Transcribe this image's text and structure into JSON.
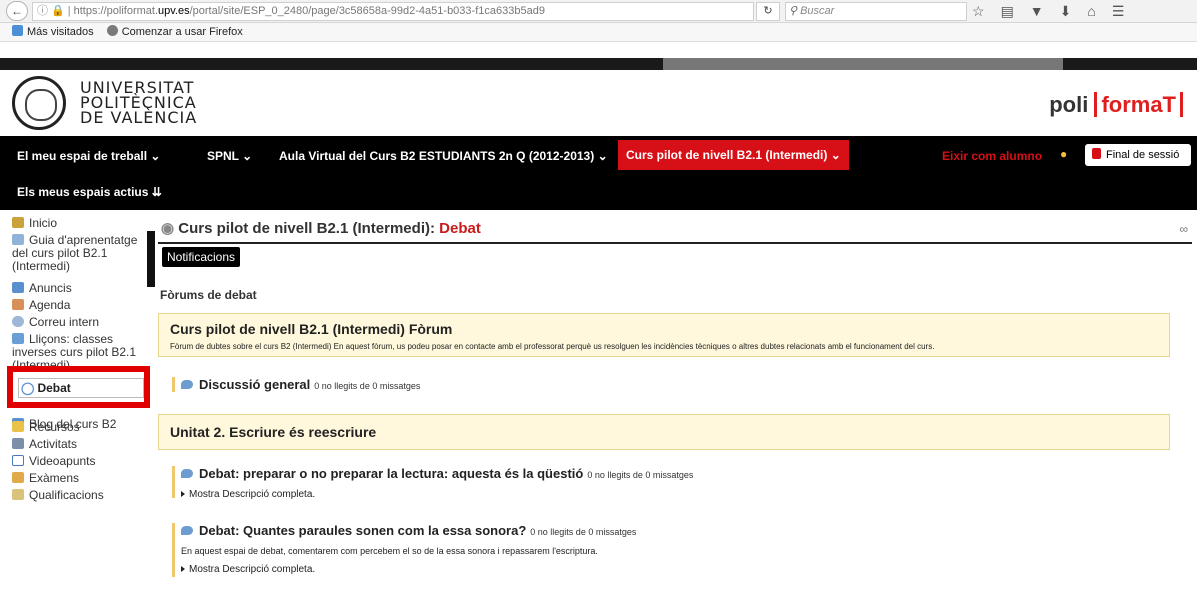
{
  "browser": {
    "url_prefix": "https://polifor­mat.",
    "url_domain": "upv.es",
    "url_path": "/portal/site/ESP_0_2480/page/3c58658a-99d2-4a51-b033-f1ca633b5ad9",
    "search_placeholder": "Buscar",
    "bookmarks": [
      "Más visitados",
      "Comenzar a usar Firefox"
    ]
  },
  "header": {
    "university_line1": "UNIVERSITAT",
    "university_line2": "POLITÈCNICA",
    "university_line3": "DE VALÈNCIA",
    "brand_poli": "poli",
    "brand_format": "formaT"
  },
  "nav": {
    "items": [
      "El meu espai de treball",
      "SPNL",
      "Aula Virtual del Curs B2 ESTUDIANTS 2n Q (2012-2013)"
    ],
    "current": "Curs pilot de nivell B2.1 (Intermedi)",
    "eixir": "Eixir com alumno",
    "logout": "Final de sessió",
    "active_spaces": "Els meus espais actius"
  },
  "sidebar": {
    "items": [
      "Inicio",
      "Guia d'aprenentatge del curs pilot B2.1 (Intermedi)",
      "Anuncis",
      "Agenda",
      "Correu intern",
      "Lliçons: classes inverses curs pilot B2.1 (Intermedi)",
      "Debat",
      "Blog del curs B2",
      "Recursos",
      "Activitats",
      "Videoapunts",
      "Exàmens",
      "Qualificacions"
    ]
  },
  "main": {
    "title_prefix": "Curs pilot de nivell B2.1 (Intermedi):",
    "title_tool": "Debat",
    "notifications": "Notificacions",
    "forums_heading": "Fòrums de debat",
    "forum1": {
      "title": "Curs pilot de nivell B2.1 (Intermedi) Fòrum",
      "description": "Fòrum de dubtes sobre el curs B2 (Intermedi) En aquest fòrum, us podeu posar en contacte amb el professorat perquè us resolguen les incidències tècniques o altres dubtes relacionats amb el funcionament del curs.",
      "topic": "Discussió general",
      "topic_count": "0 no llegits de 0 missatges"
    },
    "forum2": {
      "title": "Unitat 2. Escriure és reescriure",
      "topic1": "Debat: preparar o no preparar la lectura: aquesta és la qüestió",
      "topic1_count": "0 no llegits de 0 missatges",
      "show_full": "Mostra Descripció completa.",
      "topic2": "Debat: Quantes paraules sonen com la essa sonora?",
      "topic2_count": "0 no llegits de 0 missatges",
      "topic2_desc": "En aquest espai de debat, comentarem com percebem el so de la essa sonora i repassarem l'escriptura.",
      "show_full2": "Mostra Descripció completa."
    }
  }
}
